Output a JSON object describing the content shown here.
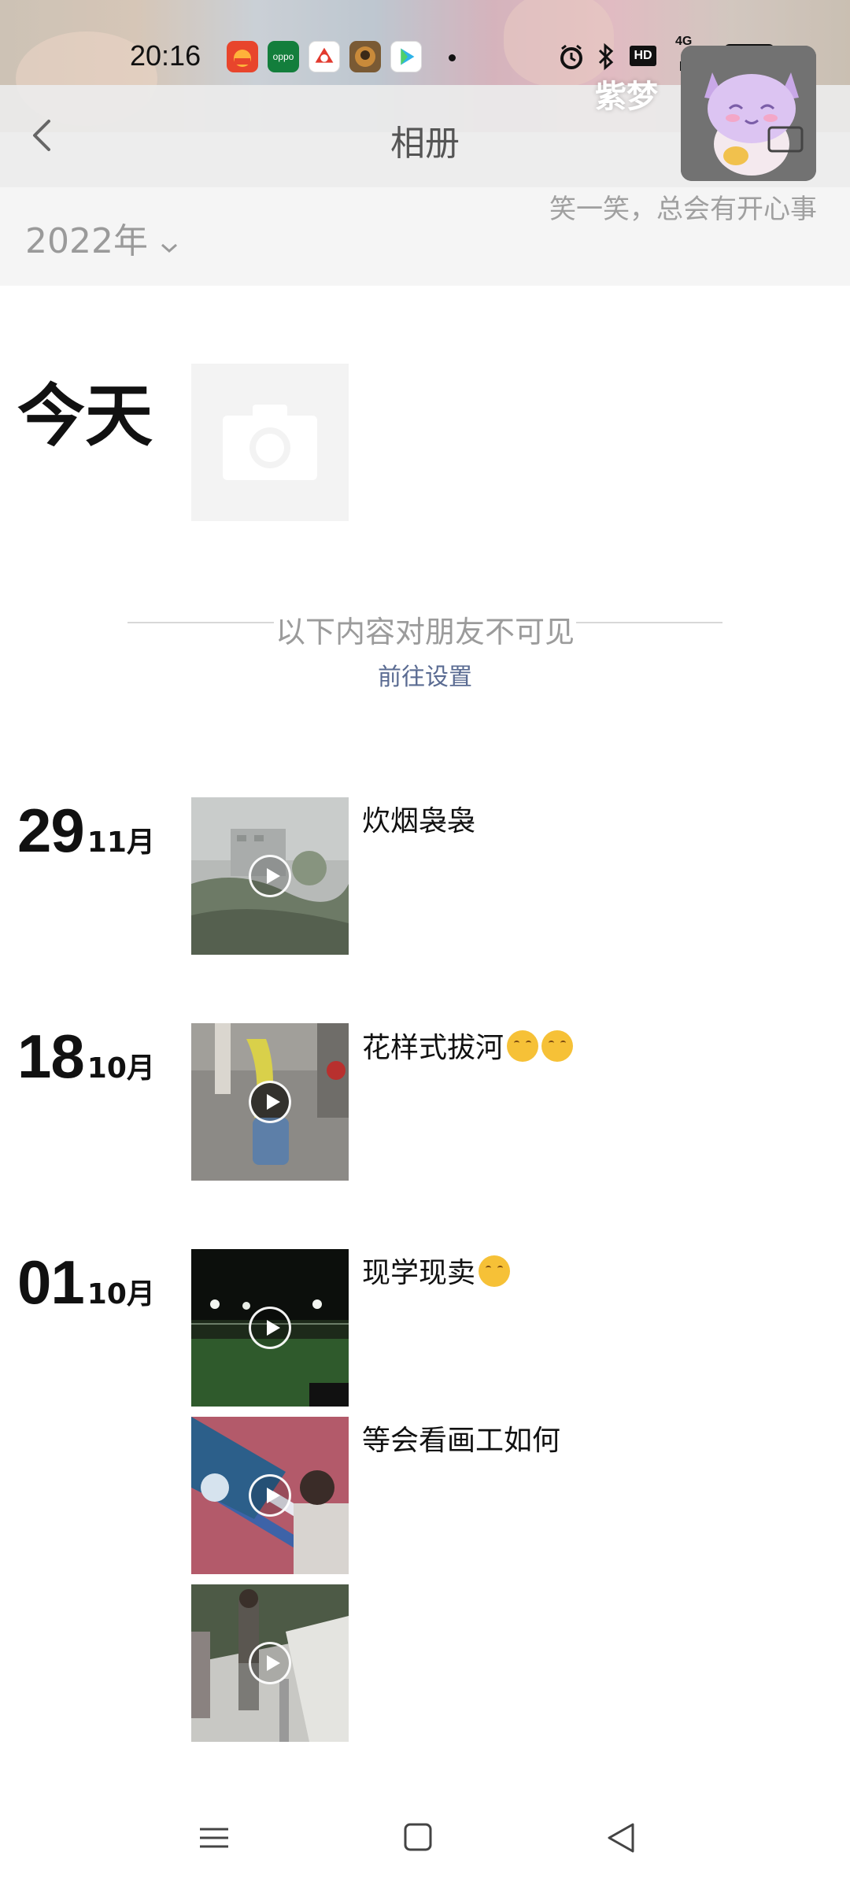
{
  "status_bar": {
    "time": "20:16",
    "apps": [
      {
        "icon": "red-app-icon",
        "color": "#e8452c",
        "label": ""
      },
      {
        "icon": "oppo-app-icon",
        "color": "#137e3c",
        "label": "oppo"
      },
      {
        "icon": "white-red-app-icon",
        "color": "#e23a2f",
        "label": ""
      },
      {
        "icon": "game-app-icon",
        "color": "#7a5a34",
        "label": ""
      },
      {
        "icon": "video-play-app-icon",
        "color": "#ffffff",
        "label": ""
      }
    ],
    "network_label": "4G",
    "hd_label": "HD",
    "battery": "63"
  },
  "header": {
    "title": "相册",
    "nickname": "紫梦"
  },
  "year_bar": {
    "year": "2022年",
    "signature": "笑一笑，总会有开心事"
  },
  "today": {
    "label": "今天"
  },
  "privacy": {
    "notice": "以下内容对朋友不可见",
    "settings_link": "前往设置"
  },
  "entries": [
    {
      "day": "29",
      "month": "11月",
      "posts": [
        {
          "caption": "炊烟袅袅",
          "emoji": 0,
          "type": "video"
        }
      ]
    },
    {
      "day": "18",
      "month": "10月",
      "posts": [
        {
          "caption": "花样式拔河",
          "emoji": 2,
          "type": "video"
        }
      ]
    },
    {
      "day": "01",
      "month": "10月",
      "posts": [
        {
          "caption": "现学现卖",
          "emoji": 1,
          "type": "video"
        },
        {
          "caption": "等会看画工如何",
          "emoji": 0,
          "type": "video"
        },
        {
          "caption": "",
          "emoji": 0,
          "type": "video"
        }
      ]
    }
  ],
  "colors": {
    "link": "#5a6b92",
    "title_bar_bg": "#ececec",
    "year_bar_bg": "#f5f5f5"
  }
}
